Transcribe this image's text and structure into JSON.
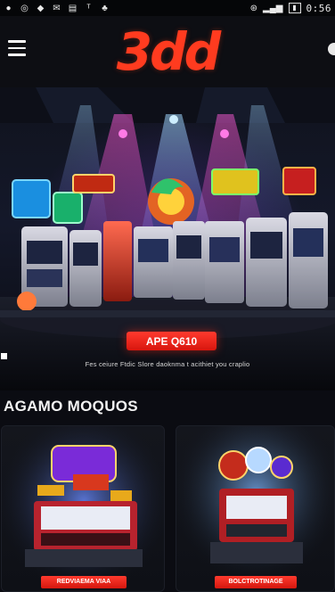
{
  "status_bar": {
    "time": "0:56",
    "left_icons": [
      "notification-icon",
      "instagram-icon",
      "chat-icon",
      "mail-icon",
      "cast-icon",
      "t-icon",
      "tree-icon"
    ],
    "right_icons": [
      "target-icon",
      "signal-icon",
      "battery-icon"
    ]
  },
  "header": {
    "logo": "3dd",
    "menu_icon": "hamburger-icon",
    "user_icon": "user-icon"
  },
  "hero": {
    "button_label": "APE Q610",
    "caption": "Fes ceiure Ftdic Slore daoknma t acithiet you craplio"
  },
  "section": {
    "title": "AGAMO MOQUOS"
  },
  "games": [
    {
      "label": "REDVIAEMA VIAA"
    },
    {
      "label": "BOLCTROTINAGE"
    }
  ],
  "colors": {
    "accent": "#ff3b1f",
    "background": "#0b0c12"
  }
}
